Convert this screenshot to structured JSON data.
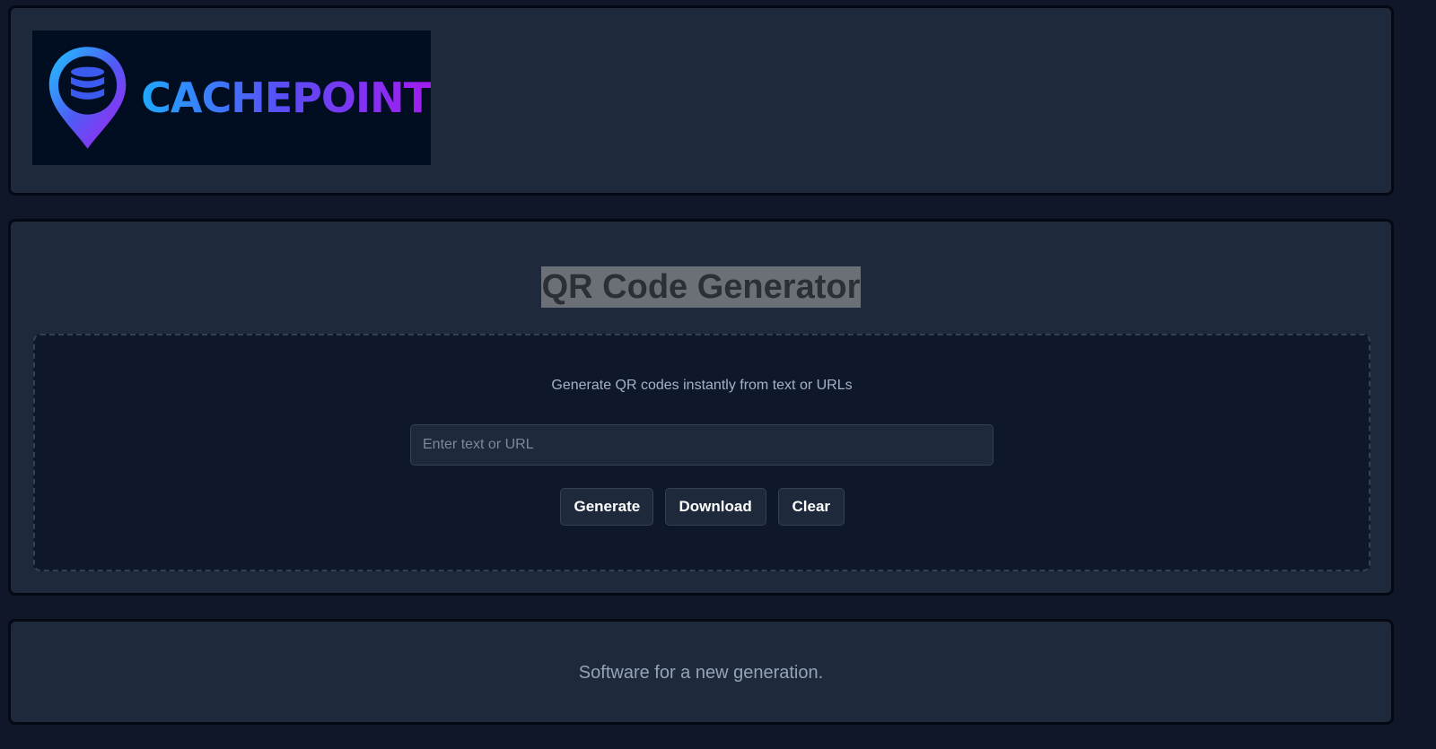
{
  "header": {
    "logo_text": "CACHEPOINT",
    "logo_icon": "database-pin-icon"
  },
  "main": {
    "title": "QR Code Generator",
    "subtitle": "Generate QR codes instantly from text or URLs",
    "input": {
      "placeholder": "Enter text or URL",
      "value": ""
    },
    "buttons": {
      "generate": "Generate",
      "download": "Download",
      "clear": "Clear"
    }
  },
  "footer": {
    "tagline": "Software for a new generation."
  },
  "colors": {
    "page_background": "#0f1729",
    "panel_background": "#1e293b",
    "dropzone_background": "#0f172a",
    "brand_gradient_start": "#1ea8ff",
    "brand_gradient_end": "#a21cf0"
  }
}
